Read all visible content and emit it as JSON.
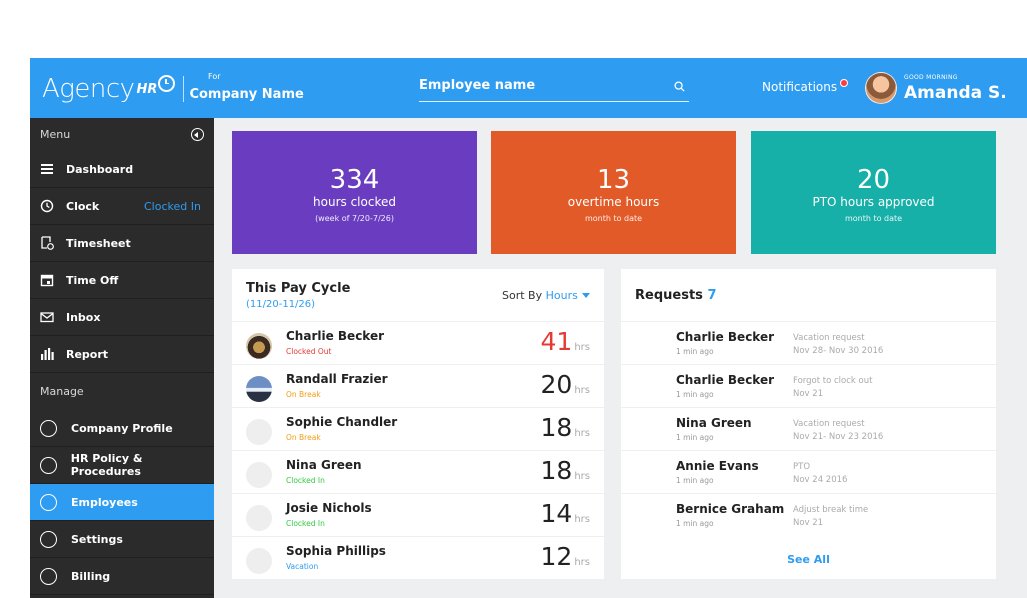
{
  "header": {
    "brand_main": "Agency",
    "brand_hr": "HR",
    "brand_for": "For",
    "company": "Company Name",
    "search_placeholder": "Employee name",
    "notifications_label": "Notifications",
    "greeting": "GOOD MORNING",
    "user_name": "Amanda S."
  },
  "sidebar": {
    "menu_label": "Menu",
    "manage_label": "Manage",
    "menu_items": [
      {
        "label": "Dashboard",
        "icon": "list-icon"
      },
      {
        "label": "Clock",
        "icon": "clock-icon",
        "tag": "Clocked In"
      },
      {
        "label": "Timesheet",
        "icon": "timesheet-icon"
      },
      {
        "label": "Time Off",
        "icon": "calendar-icon"
      },
      {
        "label": "Inbox",
        "icon": "mail-icon"
      },
      {
        "label": "Report",
        "icon": "bar-chart-icon"
      }
    ],
    "manage_items": [
      {
        "label": "Company Profile",
        "active": false
      },
      {
        "label": "HR Policy & Procedures",
        "active": false
      },
      {
        "label": "Employees",
        "active": true
      },
      {
        "label": "Settings",
        "active": false
      },
      {
        "label": "Billing",
        "active": false
      }
    ]
  },
  "stats": [
    {
      "value": "334",
      "label": "hours clocked",
      "sub": "(week of 7/20-7/26)",
      "color": "#6a3dc0"
    },
    {
      "value": "13",
      "label": "overtime hours",
      "sub": "month to date",
      "color": "#e15a28"
    },
    {
      "value": "20",
      "label": "PTO hours approved",
      "sub": "month to date",
      "color": "#16b0a8"
    }
  ],
  "pay_cycle": {
    "title": "This Pay Cycle",
    "range": "(11/20-11/26)",
    "sort_label": "Sort By",
    "sort_value": "Hours",
    "hrs_unit": "hrs",
    "rows": [
      {
        "name": "Charlie Becker",
        "status": "Clocked Out",
        "status_color": "#e53935",
        "hours": "41",
        "hours_color": "#e53935"
      },
      {
        "name": "Randall Frazier",
        "status": "On Break",
        "status_color": "#f39c12",
        "hours": "20",
        "hours_color": "#222222"
      },
      {
        "name": "Sophie Chandler",
        "status": "On Break",
        "status_color": "#f39c12",
        "hours": "18",
        "hours_color": "#222222"
      },
      {
        "name": "Nina Green",
        "status": "Clocked In",
        "status_color": "#2ecc40",
        "hours": "18",
        "hours_color": "#222222"
      },
      {
        "name": "Josie Nichols",
        "status": "Clocked In",
        "status_color": "#2ecc40",
        "hours": "14",
        "hours_color": "#222222"
      },
      {
        "name": "Sophia Phillips",
        "status": "Vacation",
        "status_color": "#2e9cf0",
        "hours": "12",
        "hours_color": "#222222"
      }
    ]
  },
  "requests": {
    "title": "Requests",
    "count": "7",
    "see_all": "See All",
    "rows": [
      {
        "name": "Charlie Becker",
        "time": "1 min ago",
        "type": "Vacation request",
        "date": "Nov 28- Nov 30 2016"
      },
      {
        "name": "Charlie Becker",
        "time": "1 min ago",
        "type": "Forgot to clock out",
        "date": "Nov 21"
      },
      {
        "name": "Nina Green",
        "time": "1 min ago",
        "type": "Vacation request",
        "date": "Nov 21- Nov 23 2016"
      },
      {
        "name": "Annie Evans",
        "time": "1 min ago",
        "type": "PTO",
        "date": "Nov 24 2016"
      },
      {
        "name": "Bernice Graham",
        "time": "1 min ago",
        "type": "Adjust break time",
        "date": "Nov 21"
      }
    ]
  }
}
